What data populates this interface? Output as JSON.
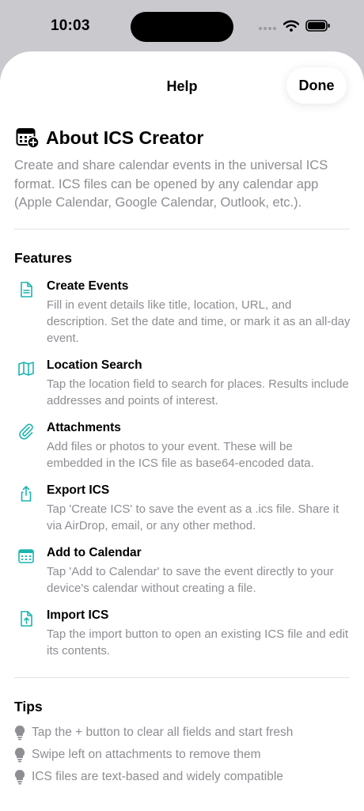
{
  "status_bar": {
    "time": "10:03"
  },
  "nav": {
    "title": "Help",
    "done_label": "Done"
  },
  "about": {
    "title": "About ICS Creator",
    "description": "Create and share calendar events in the universal ICS format. ICS files can be opened by any calendar app (Apple Calendar, Google Calendar, Outlook, etc.)."
  },
  "features": {
    "heading": "Features",
    "items": [
      {
        "icon": "document-icon",
        "title": "Create Events",
        "description": "Fill in event details like title, location, URL, and description. Set the date and time, or mark it as an all-day event."
      },
      {
        "icon": "map-icon",
        "title": "Location Search",
        "description": "Tap the location field to search for places. Results include addresses and points of interest."
      },
      {
        "icon": "paperclip-icon",
        "title": "Attachments",
        "description": "Add files or photos to your event. These will be embedded in the ICS file as base64-encoded data."
      },
      {
        "icon": "share-icon",
        "title": "Export ICS",
        "description": "Tap 'Create ICS' to save the event as a .ics file. Share it via AirDrop, email, or any other method."
      },
      {
        "icon": "calendar-icon",
        "title": "Add to Calendar",
        "description": "Tap 'Add to Calendar' to save the event directly to your device's calendar without creating a file."
      },
      {
        "icon": "import-doc-icon",
        "title": "Import ICS",
        "description": "Tap the import button to open an existing ICS file and edit its contents."
      }
    ]
  },
  "tips": {
    "heading": "Tips",
    "items": [
      "Tap the + button to clear all fields and start fresh",
      "Swipe left on attachments to remove them",
      "ICS files are text-based and widely compatible"
    ]
  },
  "colors": {
    "accent": "#1bb5b0",
    "secondary_text": "#8e8e93",
    "background": "#ffffff"
  }
}
